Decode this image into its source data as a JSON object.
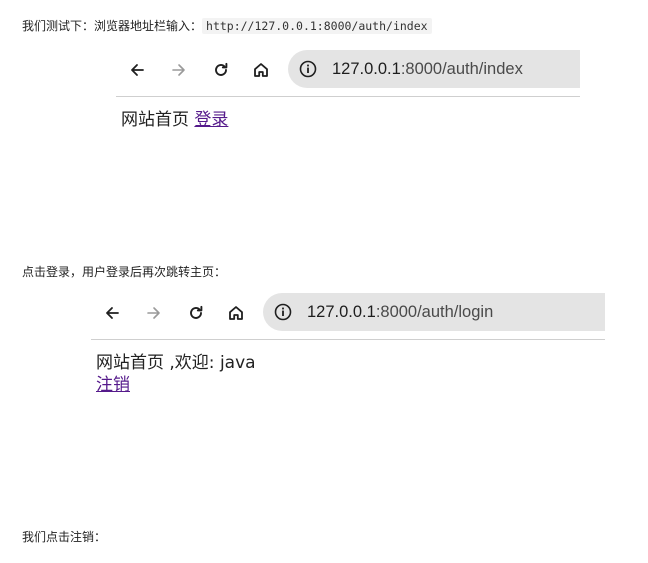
{
  "intro1": {
    "text": "我们测试下：浏览器地址栏输入：",
    "code": "http://127.0.0.1:8000/auth/index"
  },
  "browser1": {
    "url_host": "127.0.0.1",
    "url_rest": ":8000/auth/index",
    "page_text": "网站首页",
    "login_link": "登录"
  },
  "intro2": {
    "text": "点击登录，用户登录后再次跳转主页："
  },
  "browser2": {
    "url_host": "127.0.0.1",
    "url_rest": ":8000/auth/login",
    "page_text": "网站首页 ,欢迎: java",
    "logout_link": "注销"
  },
  "intro3": {
    "text": "我们点击注销："
  },
  "icons": {
    "back": "back-arrow-icon",
    "forward": "forward-arrow-icon",
    "reload": "reload-icon",
    "home": "home-icon",
    "info": "info-icon"
  },
  "colors": {
    "link_visited": "#551a8b",
    "omnibox_bg": "#e4e4e4",
    "forward_disabled": "#9a9a9a"
  }
}
